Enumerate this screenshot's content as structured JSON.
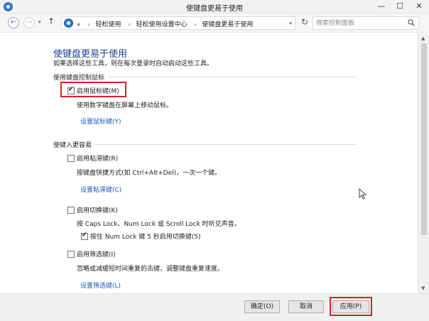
{
  "window": {
    "title": "使键盘更易于使用",
    "min": "—",
    "max": "☐",
    "close": "✕"
  },
  "address": {
    "back": "←",
    "forward": "→",
    "dropdown": "▾",
    "up": "↑",
    "overflow": "«",
    "breadcrumbs": [
      "轻松使用",
      "轻松使用设置中心",
      "使键盘更易于使用"
    ],
    "separator": "›",
    "crumb_dropdown": "▾",
    "refresh": "↻",
    "search_placeholder": "搜索控制面板"
  },
  "page": {
    "title": "使键盘更易于使用",
    "subtitle": "如果选择这些工具，则在每次登录时自动启动这些工具。"
  },
  "sections": {
    "mouse": {
      "heading": "使用键盘控制鼠标",
      "mousekeys": {
        "label": "启用鼠标键(M)",
        "checked": true,
        "desc": "使用数字键盘在屏幕上移动鼠标。",
        "link": "设置鼠标键(Y)"
      }
    },
    "typing": {
      "heading": "使键入更容易",
      "stickykeys": {
        "label": "启用粘滞键(R)",
        "checked": false,
        "desc": "按键盘快捷方式(如 Ctrl+Alt+Del)，一次一个键。",
        "link": "设置粘滞键(C)"
      },
      "togglekeys": {
        "label": "启用切换键(K)",
        "checked": false,
        "desc": "按 Caps Lock、Num Lock 或 Scroll Lock 时听见声音。",
        "sub_label": "按住 Num Lock 键 5 秒启用切换键(5)",
        "sub_checked": true
      },
      "filterkeys": {
        "label": "启用筛选键(I)",
        "checked": false,
        "desc": "忽略或减缓短时间重复的击键，调整键盘重复速度。",
        "link": "设置筛选键(L)"
      }
    }
  },
  "footer": {
    "ok": "确定(O)",
    "cancel": "取消",
    "apply": "应用(P)"
  },
  "colors": {
    "highlight": "#d7202a",
    "title_blue": "#1e3f8f",
    "link_blue": "#1a5bb4"
  }
}
